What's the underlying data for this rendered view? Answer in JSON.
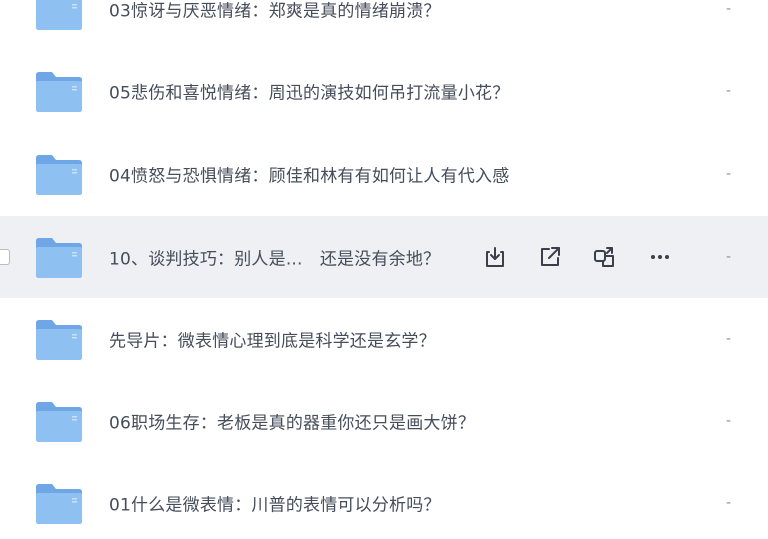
{
  "files": [
    {
      "name": "03惊讶与厌恶情绪：郑爽是真的情绪崩溃？",
      "size": "-"
    },
    {
      "name": "05悲伤和喜悦情绪：周迅的演技如何吊打流量小花？",
      "size": "-"
    },
    {
      "name": "04愤怒与恐惧情绪：顾佳和林有有如何让人有代入感",
      "size": "-"
    },
    {
      "name": "10、谈判技巧：别人是...　还是没有余地？",
      "size": "-",
      "hovered": true
    },
    {
      "name": "先导片：微表情心理到底是科学还是玄学？",
      "size": "-"
    },
    {
      "name": "06职场生存：老板是真的器重你还只是画大饼？",
      "size": "-"
    },
    {
      "name": "01什么是微表情：川普的表情可以分析吗？",
      "size": "-"
    }
  ],
  "hover_actions": [
    "download-icon",
    "share-icon",
    "copy-link-icon",
    "more-icon"
  ],
  "colors": {
    "hover_bg": "#eef0f4",
    "folder_back": "#6ea6e6",
    "folder_front": "#8fc0f2",
    "text": "#454d5a",
    "icon": "#3a3f4a"
  }
}
